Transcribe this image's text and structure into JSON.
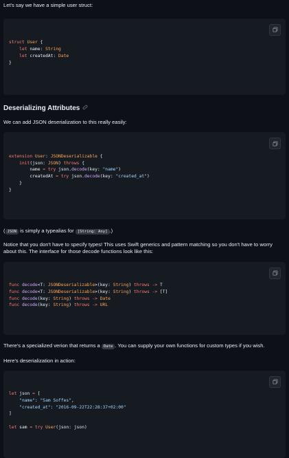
{
  "intro": "Let's say we have a simple user struct:",
  "code1": [
    [
      [
        "kw",
        "struct"
      ],
      [
        "pl",
        " "
      ],
      [
        "ty",
        "User"
      ],
      [
        "pl",
        " {"
      ]
    ],
    [
      [
        "pl",
        "    "
      ],
      [
        "kw",
        "let"
      ],
      [
        "pl",
        " name: "
      ],
      [
        "ty",
        "String"
      ]
    ],
    [
      [
        "pl",
        "    "
      ],
      [
        "kw",
        "let"
      ],
      [
        "pl",
        " createdAt: "
      ],
      [
        "ty",
        "Date"
      ]
    ],
    [
      [
        "pl",
        "}"
      ]
    ]
  ],
  "heading": "Deserializing Attributes",
  "p1": "We can add JSON deserialization to this really easily:",
  "code2": [
    [
      [
        "kw",
        "extension"
      ],
      [
        "pl",
        " "
      ],
      [
        "ty",
        "User"
      ],
      [
        "pl",
        ": "
      ],
      [
        "ty",
        "JSONDeserializable"
      ],
      [
        "pl",
        " {"
      ]
    ],
    [
      [
        "pl",
        "    "
      ],
      [
        "kw",
        "init"
      ],
      [
        "pl",
        "(json: "
      ],
      [
        "ty",
        "JSON"
      ],
      [
        "pl",
        ") "
      ],
      [
        "kw",
        "throws"
      ],
      [
        "pl",
        " {"
      ]
    ],
    [
      [
        "pl",
        "        name "
      ],
      [
        "op",
        "="
      ],
      [
        "pl",
        " "
      ],
      [
        "kw",
        "try"
      ],
      [
        "pl",
        " json."
      ],
      [
        "fn",
        "decode"
      ],
      [
        "pl",
        "(key: "
      ],
      [
        "st",
        "\"name\""
      ],
      [
        "pl",
        ")"
      ]
    ],
    [
      [
        "pl",
        "        createdAt "
      ],
      [
        "op",
        "="
      ],
      [
        "pl",
        " "
      ],
      [
        "kw",
        "try"
      ],
      [
        "pl",
        " json."
      ],
      [
        "fn",
        "decode"
      ],
      [
        "pl",
        "(key: "
      ],
      [
        "st",
        "\"created_at\""
      ],
      [
        "pl",
        ")"
      ]
    ],
    [
      [
        "pl",
        "    }"
      ]
    ],
    [
      [
        "pl",
        "}"
      ]
    ]
  ],
  "p2": {
    "pre": "(",
    "code_a": "JSON",
    "mid": " is simply a typealias for ",
    "code_b": "[String: Any]",
    "post": ".)"
  },
  "p3": "Notice that you don't have to specify types! This uses Swift generics and pattern matching so you don't have to worry about this. The interface for those decode functions look like this:",
  "code3": [
    [
      [
        "kw",
        "func"
      ],
      [
        "pl",
        " "
      ],
      [
        "fn",
        "decode"
      ],
      [
        "pl",
        "<T: "
      ],
      [
        "ty",
        "JSONDeserializable"
      ],
      [
        "pl",
        ">(key: "
      ],
      [
        "ty",
        "String"
      ],
      [
        "pl",
        ") "
      ],
      [
        "kw",
        "throws"
      ],
      [
        "pl",
        " "
      ],
      [
        "op",
        "->"
      ],
      [
        "pl",
        " T"
      ]
    ],
    [
      [
        "kw",
        "func"
      ],
      [
        "pl",
        " "
      ],
      [
        "fn",
        "decode"
      ],
      [
        "pl",
        "<T: "
      ],
      [
        "ty",
        "JSONDeserializable"
      ],
      [
        "pl",
        ">(key: "
      ],
      [
        "ty",
        "String"
      ],
      [
        "pl",
        ") "
      ],
      [
        "kw",
        "throws"
      ],
      [
        "pl",
        " "
      ],
      [
        "op",
        "->"
      ],
      [
        "pl",
        " [T]"
      ]
    ],
    [
      [
        "kw",
        "func"
      ],
      [
        "pl",
        " "
      ],
      [
        "fn",
        "decode"
      ],
      [
        "pl",
        "(key: "
      ],
      [
        "ty",
        "String"
      ],
      [
        "pl",
        ") "
      ],
      [
        "kw",
        "throws"
      ],
      [
        "pl",
        " "
      ],
      [
        "op",
        "->"
      ],
      [
        "pl",
        " "
      ],
      [
        "ty",
        "Date"
      ]
    ],
    [
      [
        "kw",
        "func"
      ],
      [
        "pl",
        " "
      ],
      [
        "fn",
        "decode"
      ],
      [
        "pl",
        "(key: "
      ],
      [
        "ty",
        "String"
      ],
      [
        "pl",
        ") "
      ],
      [
        "kw",
        "throws"
      ],
      [
        "pl",
        " "
      ],
      [
        "op",
        "->"
      ],
      [
        "pl",
        " "
      ],
      [
        "ty",
        "URL"
      ]
    ]
  ],
  "p4": {
    "pre": "There's a specialized verion that returns a ",
    "code": "Date",
    "post": ". You can supply your own functions for custom types if you wish."
  },
  "p5": "Here's deserialization in action:",
  "code4": [
    [
      [
        "kw",
        "let"
      ],
      [
        "pl",
        " json "
      ],
      [
        "op",
        "="
      ],
      [
        "pl",
        " ["
      ]
    ],
    [
      [
        "pl",
        "    "
      ],
      [
        "st",
        "\"name\""
      ],
      [
        "pl",
        ": "
      ],
      [
        "st",
        "\"Sam Soffes\""
      ],
      [
        "pl",
        ","
      ]
    ],
    [
      [
        "pl",
        "    "
      ],
      [
        "st",
        "\"created_at\""
      ],
      [
        "pl",
        ": "
      ],
      [
        "st",
        "\"2016-09-22T22:28:37+02:00\""
      ]
    ],
    [
      [
        "pl",
        "]"
      ]
    ],
    [
      [
        "pl",
        " "
      ]
    ],
    [
      [
        "kw",
        "let"
      ],
      [
        "pl",
        " sam "
      ],
      [
        "op",
        "="
      ],
      [
        "pl",
        " "
      ],
      [
        "kw",
        "try"
      ],
      [
        "pl",
        " "
      ],
      [
        "ty",
        "User"
      ],
      [
        "pl",
        "(json: json)"
      ]
    ]
  ],
  "icons": {
    "copy": "copy-icon",
    "link": "link-icon"
  },
  "colors": {
    "background": "#0d1117",
    "code_background": "#161b22",
    "keyword": "#ff7b72",
    "type": "#ffa657",
    "function": "#d2a8ff",
    "string": "#a5d6ff"
  }
}
